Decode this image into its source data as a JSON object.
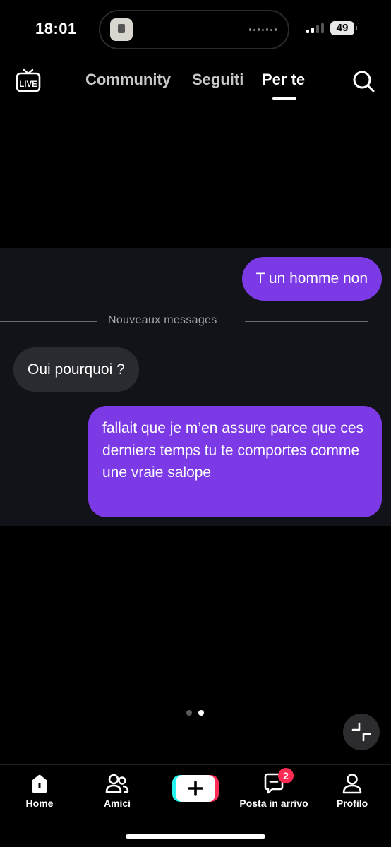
{
  "status_bar": {
    "time": "18:01",
    "battery": "49",
    "icons": [
      "island-app-icon",
      "signal-icon",
      "battery-icon"
    ]
  },
  "top_nav": {
    "tabs": [
      {
        "label": "Community",
        "active": false
      },
      {
        "label": "Seguiti",
        "active": false
      },
      {
        "label": "Per te",
        "active": true
      }
    ],
    "live_label": "LIVE",
    "icons": [
      "live-tv-icon",
      "search-icon"
    ]
  },
  "chat": {
    "messages": [
      {
        "direction": "out",
        "text": "T un homme non"
      },
      {
        "direction": "in",
        "text": "Oui pourquoi ?"
      },
      {
        "direction": "out",
        "text": "fallait que je m’en assure parce que ces derniers temps tu te comportes comme une vraie salope"
      }
    ],
    "divider_label": "Nouveaux messages",
    "colors": {
      "outgoing": "#7b3ae6",
      "incoming": "#2a2b31",
      "panel": "#121318"
    }
  },
  "pager": {
    "count": 2,
    "active_index": 2
  },
  "bottom_nav": {
    "items": [
      {
        "label": "Home",
        "icon": "home-icon"
      },
      {
        "label": "Amici",
        "icon": "friends-icon"
      },
      {
        "label": "Posta in arrivo",
        "icon": "inbox-icon",
        "badge": "2"
      },
      {
        "label": "Profilo",
        "icon": "profile-icon"
      }
    ],
    "create_icon": "create-plus-icon",
    "accent_colors": {
      "cyan": "#25f4ee",
      "red": "#fe2c55"
    }
  }
}
